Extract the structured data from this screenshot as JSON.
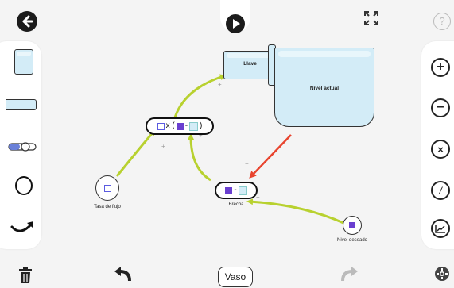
{
  "toolbar": {
    "mode_label": "Vaso"
  },
  "nodes": {
    "faucet_label": "Llave",
    "tank_label": "Nivel actual",
    "flow_rate_label": "Tasa de flujo",
    "gap_label": "Brecha",
    "desired_level_label": "Nivel deseado",
    "formula_text_x": "x (",
    "formula_minus": "-",
    "formula_close": ")",
    "gap_minus": "-"
  },
  "small_signs": {
    "plus": "+",
    "minus": "−"
  },
  "colors": {
    "link": "#b8d12f",
    "negative_link": "#e8442e",
    "stock_fill": "#d3ecf7",
    "variable_fill": "#6a3fd0"
  }
}
